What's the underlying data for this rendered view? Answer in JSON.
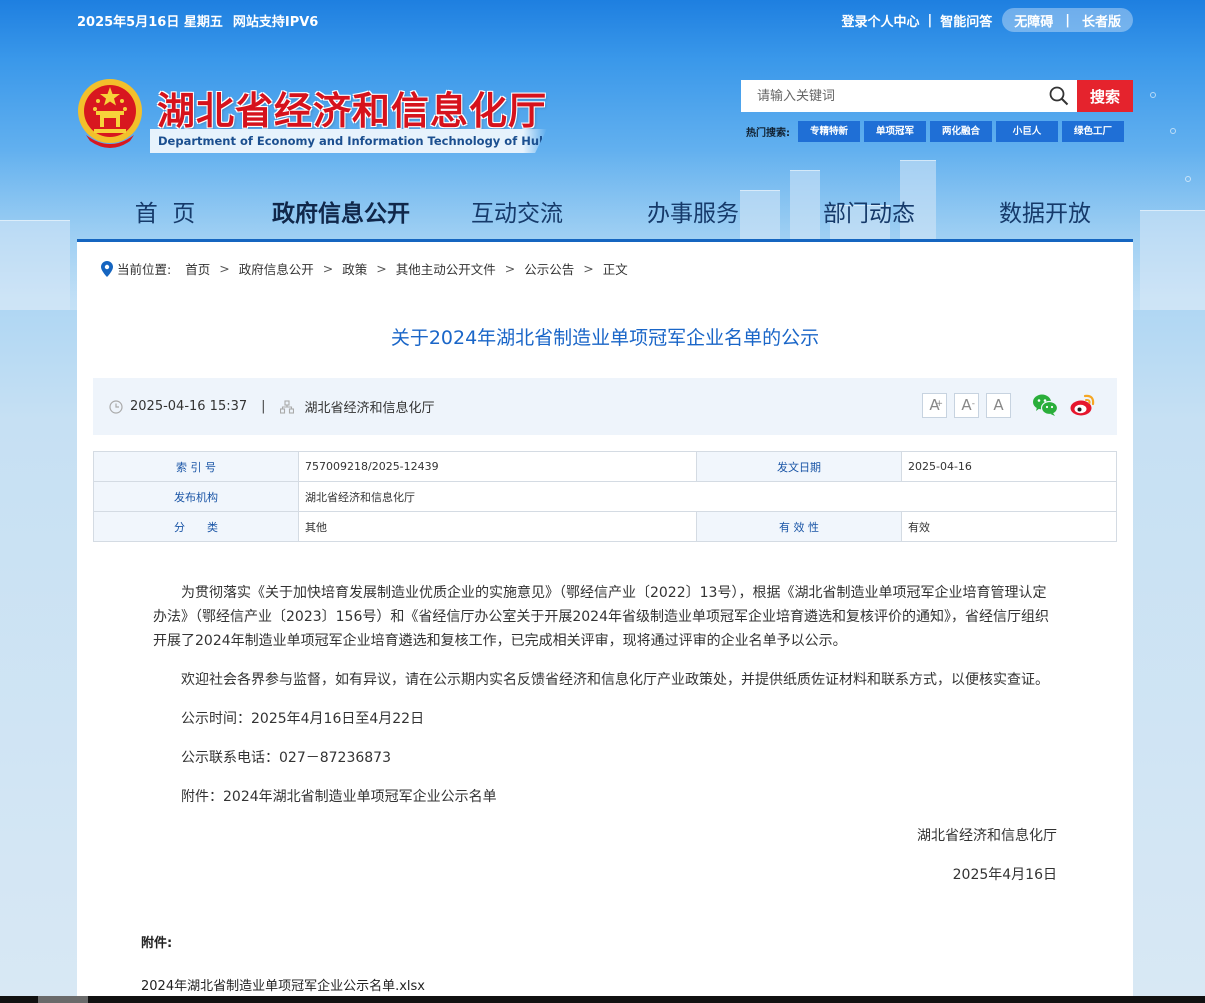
{
  "topbar": {
    "date": "2025年5月16日 星期五",
    "ipv6": "网站支持IPV6",
    "login": "登录个人中心",
    "sep": "|",
    "qa": "智能问答",
    "accessible": "无障碍",
    "elder": "长者版"
  },
  "brand": {
    "title": "湖北省经济和信息化厅",
    "subtitle": "Department of Economy and Information Technology of Hubei Province",
    "emblem_icon": "national-emblem-icon"
  },
  "search": {
    "placeholder": "请输入关键词",
    "button": "搜索",
    "hot_label": "热门搜索:",
    "hot_tags": [
      "专精特新",
      "单项冠军",
      "两化融合",
      "小巨人",
      "绿色工厂"
    ]
  },
  "nav": {
    "items": [
      "首  页",
      "政府信息公开",
      "互动交流",
      "办事服务",
      "部门动态",
      "数据开放"
    ],
    "active": "政府信息公开"
  },
  "breadcrumb": {
    "label": "当前位置:",
    "items": [
      "首页",
      "政府信息公开",
      "政策",
      "其他主动公开文件",
      "公示公告",
      "正文"
    ],
    "arrow": ">"
  },
  "article": {
    "title": "关于2024年湖北省制造业单项冠军企业名单的公示",
    "datetime": "2025-04-16 15:37",
    "separator": "|",
    "source": "湖北省经济和信息化厅",
    "font_buttons": [
      "A",
      "A",
      "A"
    ],
    "font_plus": "+",
    "font_minus": "-"
  },
  "info_table": {
    "index_key": "索 引 号",
    "index_val": "757009218/2025-12439",
    "date_key": "发文日期",
    "date_val": "2025-04-16",
    "publisher_key": "发布机构",
    "publisher_val": "湖北省经济和信息化厅",
    "category_key": "分　　类",
    "category_val": "其他",
    "validity_key": "有 效 性",
    "validity_val": "有效"
  },
  "body": {
    "p1": "为贯彻落实《关于加快培育发展制造业优质企业的实施意见》（鄂经信产业〔2022〕13号），根据《湖北省制造业单项冠军企业培育管理认定办法》（鄂经信产业〔2023〕156号）和《省经信厅办公室关于开展2024年省级制造业单项冠军企业培育遴选和复核评价的通知》，省经信厅组织开展了2024年制造业单项冠军企业培育遴选和复核工作，已完成相关评审，现将通过评审的企业名单予以公示。",
    "p2": "欢迎社会各界参与监督，如有异议，请在公示期内实名反馈省经济和信息化厅产业政策处，并提供纸质佐证材料和联系方式，以便核实查证。",
    "p3": "公示时间：2025年4月16日至4月22日",
    "p4": "公示联系电话：027－87236873",
    "p5": "附件：2024年湖北省制造业单项冠军企业公示名单",
    "sign_org": "湖北省经济和信息化厅",
    "sign_date": "2025年4月16日"
  },
  "attachment": {
    "label": "附件:",
    "file": "2024年湖北省制造业单项冠军企业公示名单.xlsx"
  },
  "colors": {
    "brand_red": "#d6121c",
    "search_red": "#e5232d",
    "title_blue": "#1a66c8",
    "nav_underline": "#1565c0",
    "tag_blue": "#1f6fd6"
  }
}
